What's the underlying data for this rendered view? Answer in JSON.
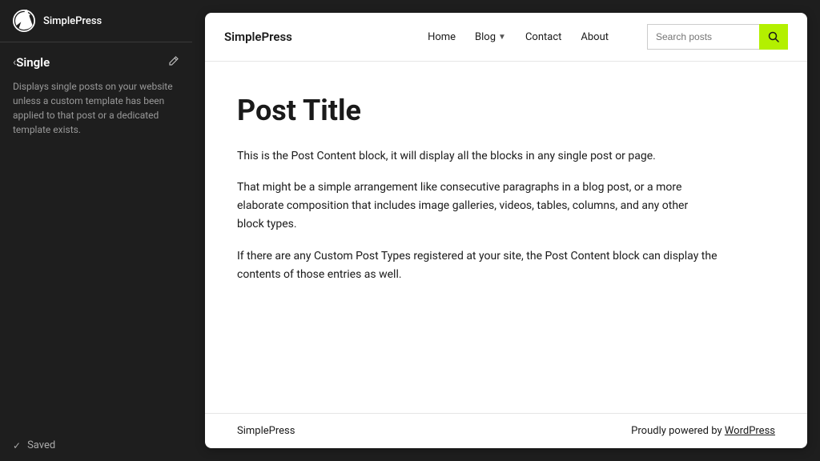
{
  "sidebar": {
    "site_name": "SimplePress",
    "back_label": "",
    "section_title": "Single",
    "description": "Displays single posts on your website unless a custom template has been applied to that post or a dedicated template exists.",
    "saved_label": "Saved"
  },
  "preview": {
    "header": {
      "logo": "SimplePress",
      "nav": [
        {
          "label": "Home",
          "has_dropdown": false
        },
        {
          "label": "Blog",
          "has_dropdown": true
        },
        {
          "label": "Contact",
          "has_dropdown": false
        },
        {
          "label": "About",
          "has_dropdown": false
        }
      ],
      "search_placeholder": "Search posts"
    },
    "content": {
      "post_title": "Post Title",
      "paragraphs": [
        "This is the Post Content block, it will display all the blocks in any single post or page.",
        "That might be a simple arrangement like consecutive paragraphs in a blog post, or a more elaborate composition that includes image galleries, videos, tables, columns, and any other block types.",
        "If there are any Custom Post Types registered at your site, the Post Content block can display the contents of those entries as well."
      ]
    },
    "footer": {
      "logo": "SimplePress",
      "powered_by_text": "Proudly powered by ",
      "powered_by_link": "WordPress"
    }
  },
  "colors": {
    "search_btn_bg": "#b3f000",
    "sidebar_bg": "#1e1e1e"
  }
}
